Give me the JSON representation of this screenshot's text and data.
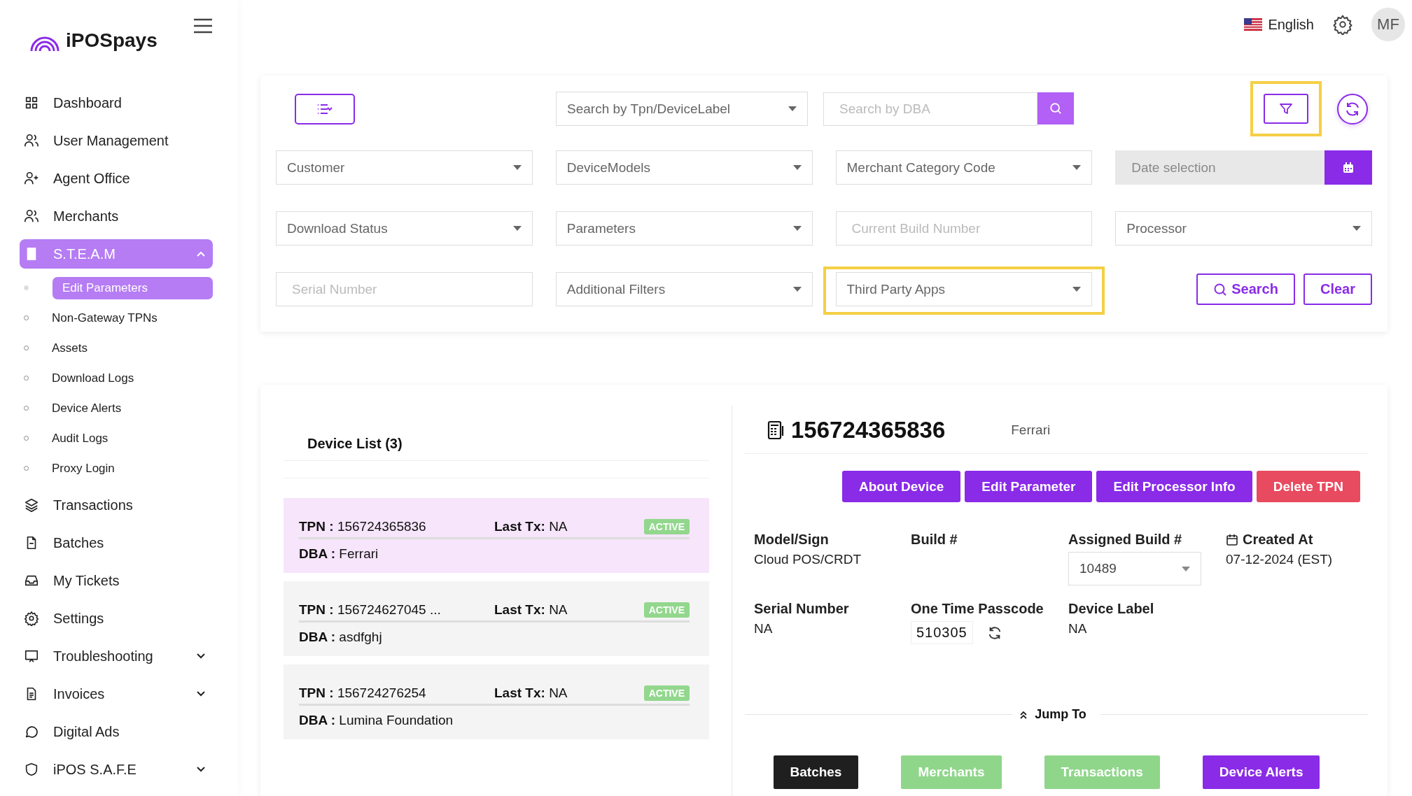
{
  "header": {
    "language": "English",
    "avatar": "MF"
  },
  "sidebar": {
    "logo": "iPOSpays",
    "items": [
      {
        "label": "Dashboard",
        "selected": false
      },
      {
        "label": "User Management",
        "selected": false
      },
      {
        "label": "Agent Office",
        "selected": false
      },
      {
        "label": "Merchants",
        "selected": false
      },
      {
        "label": "S.T.E.A.M",
        "selected": true,
        "expanded": true,
        "children": [
          {
            "label": "Edit Parameters",
            "selected": true
          },
          {
            "label": "Non-Gateway TPNs",
            "selected": false
          },
          {
            "label": "Assets",
            "selected": false
          },
          {
            "label": "Download Logs",
            "selected": false
          },
          {
            "label": "Device Alerts",
            "selected": false
          },
          {
            "label": "Audit Logs",
            "selected": false
          },
          {
            "label": "Proxy Login",
            "selected": false
          }
        ]
      },
      {
        "label": "Transactions",
        "selected": false
      },
      {
        "label": "Batches",
        "selected": false
      },
      {
        "label": "My Tickets",
        "selected": false
      },
      {
        "label": "Settings",
        "selected": false
      },
      {
        "label": "Troubleshooting",
        "selected": false,
        "expanded": false
      },
      {
        "label": "Invoices",
        "selected": false,
        "expanded": false
      },
      {
        "label": "Digital Ads",
        "selected": false
      },
      {
        "label": "iPOS S.A.F.E",
        "selected": false,
        "expanded": false
      }
    ]
  },
  "filters": {
    "tpn_search": {
      "placeholder": "Search by Tpn/DeviceLabel"
    },
    "dba_search": {
      "placeholder": "Search by DBA"
    },
    "filter_button": {
      "highlighted": true
    },
    "fields": [
      {
        "kind": "select",
        "placeholder": "Customer",
        "highlighted": false
      },
      {
        "kind": "select",
        "placeholder": "DeviceModels",
        "highlighted": false
      },
      {
        "kind": "select",
        "placeholder": "Merchant Category Code",
        "highlighted": false
      },
      {
        "kind": "date",
        "placeholder": "Date selection",
        "highlighted": false
      },
      {
        "kind": "select",
        "placeholder": "Download Status",
        "highlighted": false
      },
      {
        "kind": "select",
        "placeholder": "Parameters",
        "highlighted": false
      },
      {
        "kind": "input",
        "placeholder": "Current Build Number",
        "highlighted": false
      },
      {
        "kind": "select",
        "placeholder": "Processor",
        "highlighted": false
      },
      {
        "kind": "input",
        "placeholder": "Serial Number",
        "highlighted": false
      },
      {
        "kind": "select",
        "placeholder": "Additional Filters",
        "highlighted": false
      },
      {
        "kind": "select",
        "placeholder": "Third Party Apps",
        "highlighted": true
      }
    ],
    "search_button": "Search",
    "clear_button": "Clear"
  },
  "device_list": {
    "title": "Device List (3)",
    "rows": [
      {
        "tpn": "**TPN :** 156724365836",
        "last_tx": "**Last Tx:** NA",
        "status": "ACTIVE",
        "dba": "**DBA :** Ferrari",
        "selected": true
      },
      {
        "tpn": "**TPN :** 156724627045 ...",
        "last_tx": "**Last Tx:** NA",
        "status": "ACTIVE",
        "dba": "**DBA :** asdfghj",
        "selected": false
      },
      {
        "tpn": "**TPN :** 156724276254",
        "last_tx": "**Last Tx:** NA",
        "status": "ACTIVE",
        "dba": "**DBA :** Lumina Foundation",
        "selected": false
      }
    ]
  },
  "device_detail": {
    "tpn": "156724365836",
    "dba": "Ferrari",
    "actions": [
      {
        "label": "About Device",
        "kind": "primary"
      },
      {
        "label": "Edit Parameter",
        "kind": "primary"
      },
      {
        "label": "Edit Processor Info",
        "kind": "primary"
      },
      {
        "label": "Delete TPN",
        "kind": "danger"
      }
    ],
    "fields": [
      {
        "kind": "text",
        "label": "Model/Sign",
        "value": "Cloud POS/CRDT"
      },
      {
        "kind": "text",
        "label": "Build #"
      },
      {
        "kind": "select",
        "label": "Assigned Build #",
        "value": "10489"
      },
      {
        "kind": "date",
        "label": "Created At",
        "value": "07-12-2024 (EST)"
      },
      {
        "kind": "text",
        "label": "Serial Number",
        "value": "NA"
      },
      {
        "kind": "otp",
        "label": "One Time Passcode",
        "value": "510305"
      },
      {
        "kind": "text",
        "label": "Device Label",
        "value": "NA"
      }
    ],
    "jump_label": "Jump To",
    "jump_buttons": [
      {
        "label": "Batches",
        "color": "#1f1f1f"
      },
      {
        "label": "Merchants",
        "color": "#8fd68b"
      },
      {
        "label": "Transactions",
        "color": "#8fd68b"
      },
      {
        "label": "Device Alerts",
        "color": "#8a2be8"
      }
    ]
  }
}
